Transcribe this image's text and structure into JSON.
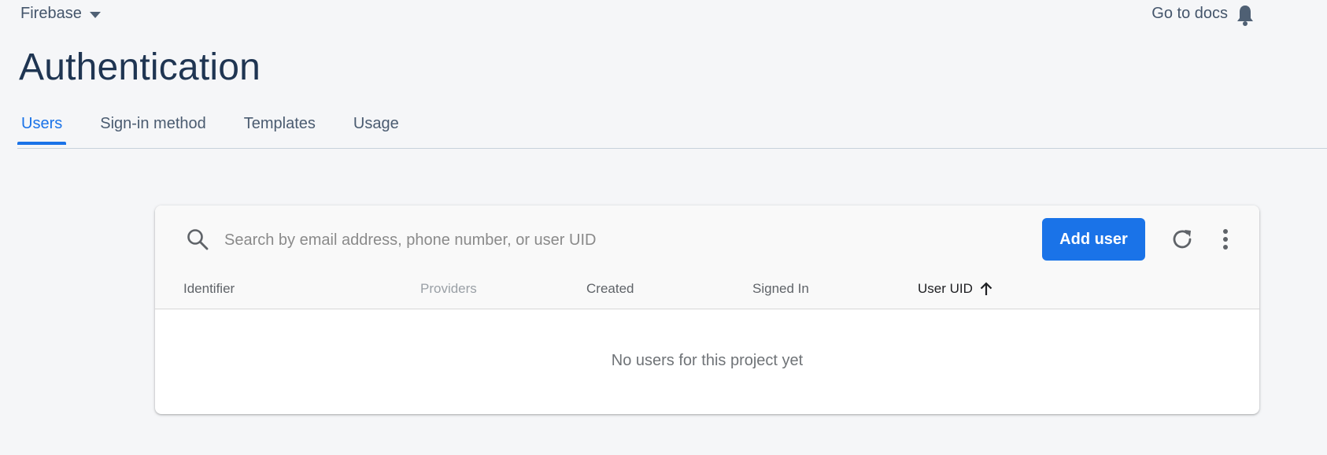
{
  "topbar": {
    "project_name": "Firebase",
    "docs_link": "Go to docs"
  },
  "page": {
    "title": "Authentication"
  },
  "tabs": [
    {
      "label": "Users",
      "active": true
    },
    {
      "label": "Sign-in method",
      "active": false
    },
    {
      "label": "Templates",
      "active": false
    },
    {
      "label": "Usage",
      "active": false
    }
  ],
  "users_table": {
    "search_placeholder": "Search by email address, phone number, or user UID",
    "search_value": "",
    "add_user_label": "Add user",
    "columns": [
      {
        "label": "Identifier"
      },
      {
        "label": "Providers"
      },
      {
        "label": "Created"
      },
      {
        "label": "Signed In"
      },
      {
        "label": "User UID",
        "sort": "ascending"
      }
    ],
    "rows": [],
    "empty_message": "No users for this project yet"
  },
  "colors": {
    "accent": "#1a73e8",
    "title": "#1f3552",
    "background": "#f5f6f8"
  },
  "icons": [
    "caret-down-icon",
    "bell-icon",
    "search-icon",
    "refresh-icon",
    "more-vert-icon",
    "arrow-up-icon"
  ]
}
